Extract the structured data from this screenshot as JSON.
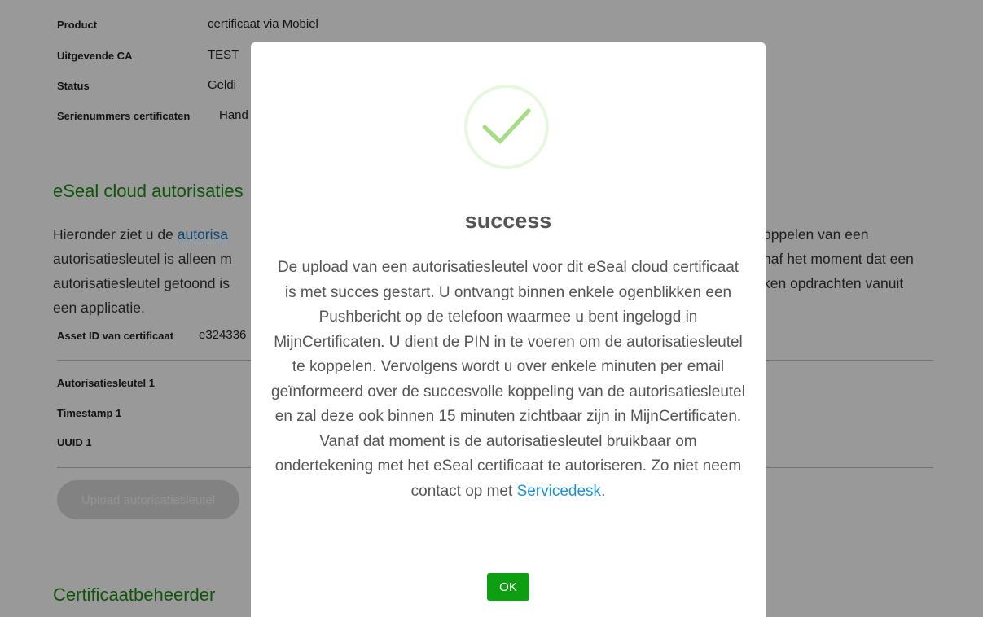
{
  "details": {
    "rows": [
      {
        "label": "Product",
        "value": "certificaat via Mobiel"
      },
      {
        "label": "Uitgevende CA",
        "value": "TEST"
      },
      {
        "label": "Status",
        "value": "Geldi"
      },
      {
        "label": "Serienummers certificaten",
        "value": "Hand"
      }
    ]
  },
  "eseal": {
    "heading": "eSeal cloud autorisaties",
    "para_pre": "Hieronder ziet u de ",
    "para_link": "autorisa",
    "para_rest_1": "oppelen van een",
    "para_line2_left": "autorisatiesleutel is alleen m",
    "para_line2_right": "naf het moment dat een",
    "para_line3_left": "autorisatiesleutel getoond is",
    "para_line3_right": "ken opdrachten vanuit",
    "para_line4": "een applicatie.",
    "asset_label": "Asset ID van certificaat",
    "asset_value": "e324336",
    "key_rows": [
      {
        "label": "Autorisatiesleutel 1"
      },
      {
        "label": "Timestamp 1"
      },
      {
        "label": "UUID 1"
      }
    ],
    "upload_label": "Upload autorisatiesleutel"
  },
  "beheerder": {
    "heading": "Certificaatbeheerder"
  },
  "modal": {
    "title": "success",
    "text": "De upload van een autorisatiesleutel voor dit eSeal cloud certificaat is met succes gestart. U ontvangt binnen enkele ogenblikken een Pushbericht op de telefoon waarmee u bent ingelogd in MijnCertificaten. U dient de PIN in te voeren om de autorisatiesleutel te koppelen. Vervolgens wordt u over enkele minuten per email geïnformeerd over de succesvolle koppeling van de autorisatiesleutel en zal deze ook binnen 15 minuten zichtbaar zijn in MijnCertificaten. Vanaf dat moment is de autorisatiesleutel bruikbaar om ondertekening met het eSeal certificaat te autoriseren. Zo niet neem contact op met ",
    "link": "Servicedesk",
    "text_end": ".",
    "ok_label": "OK",
    "icon": "success-check-icon"
  }
}
